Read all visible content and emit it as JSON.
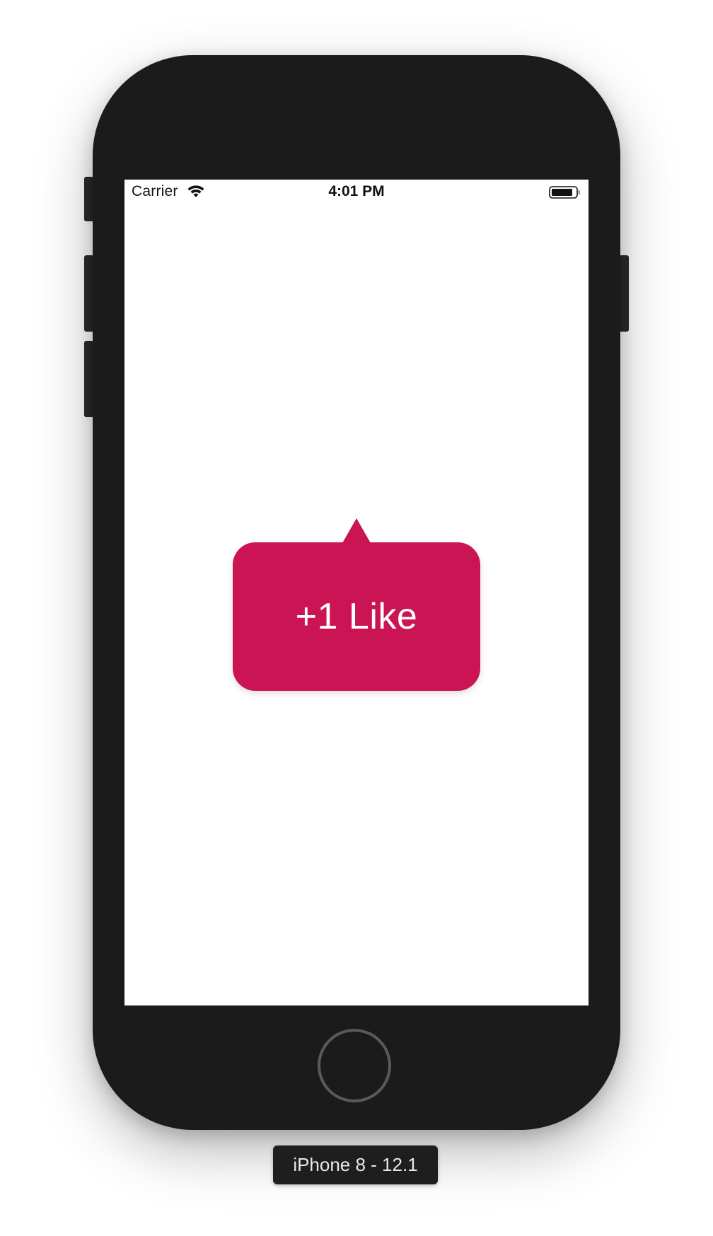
{
  "status_bar": {
    "carrier": "Carrier",
    "time": "4:01 PM",
    "wifi_icon": "wifi-icon",
    "battery_icon": "battery-icon"
  },
  "tooltip": {
    "label": "+1 Like",
    "color": "#cb1454"
  },
  "simulator": {
    "device_label": "iPhone 8 - 12.1",
    "home_button_icon": "home-button"
  }
}
